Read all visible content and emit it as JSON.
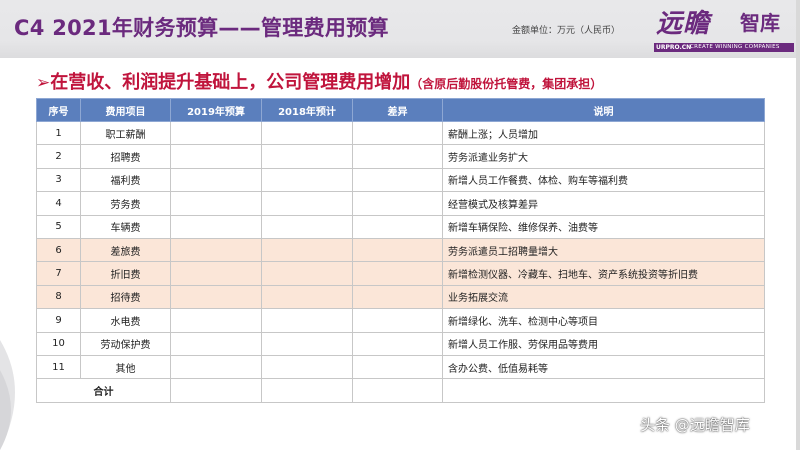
{
  "header": {
    "title": "C4  2021年财务预算——管理费用预算",
    "unit": "金额单位：万元（人民币）",
    "logo": {
      "name_part1": "远瞻",
      "name_part2": "智库",
      "url": "URPRO.CN",
      "slogan": "CREATE WINNING COMPANIES"
    }
  },
  "headline": {
    "arrow": "➢",
    "main": "在营收、利润提升基础上，公司管理费用增加",
    "note": "（含原后勤股份托管费，集团承担）"
  },
  "table": {
    "headers": [
      "序号",
      "费用项目",
      "2019年预算",
      "2018年预计",
      "差异",
      "说明"
    ],
    "rows": [
      {
        "no": "1",
        "item": "职工薪酬",
        "b2019": "",
        "e2018": "",
        "diff": "",
        "desc": "薪酬上涨；人员增加"
      },
      {
        "no": "2",
        "item": "招聘费",
        "b2019": "",
        "e2018": "",
        "diff": "",
        "desc": "劳务派遣业务扩大"
      },
      {
        "no": "3",
        "item": "福利费",
        "b2019": "",
        "e2018": "",
        "diff": "",
        "desc": "新增人员工作餐费、体检、购车等福利费"
      },
      {
        "no": "4",
        "item": "劳务费",
        "b2019": "",
        "e2018": "",
        "diff": "",
        "desc": "经营模式及核算差异"
      },
      {
        "no": "5",
        "item": "车辆费",
        "b2019": "",
        "e2018": "",
        "diff": "",
        "desc": "新增车辆保险、维修保养、油费等"
      },
      {
        "no": "6",
        "item": "差旅费",
        "b2019": "",
        "e2018": "",
        "diff": "",
        "desc": "劳务派遣员工招聘量增大"
      },
      {
        "no": "7",
        "item": "折旧费",
        "b2019": "",
        "e2018": "",
        "diff": "",
        "desc": "新增检测仪器、冷藏车、扫地车、资产系统投资等折旧费"
      },
      {
        "no": "8",
        "item": "招待费",
        "b2019": "",
        "e2018": "",
        "diff": "",
        "desc": "业务拓展交流"
      },
      {
        "no": "9",
        "item": "水电费",
        "b2019": "",
        "e2018": "",
        "diff": "",
        "desc": "新增绿化、洗车、检测中心等项目"
      },
      {
        "no": "10",
        "item": "劳动保护费",
        "b2019": "",
        "e2018": "",
        "diff": "",
        "desc": "新增人员工作服、劳保用品等费用"
      },
      {
        "no": "11",
        "item": "其他",
        "b2019": "",
        "e2018": "",
        "diff": "",
        "desc": "含办公费、低值易耗等"
      },
      {
        "no": "",
        "item": "合计",
        "b2019": "",
        "e2018": "",
        "diff": "",
        "desc": ""
      }
    ]
  },
  "watermark": "头条 @远瞻智库",
  "colors": {
    "title": "#6b2a7e",
    "headline": "#c0143c",
    "table_header": "#5b7fbd",
    "highlight_row": "#fbe6d8"
  }
}
